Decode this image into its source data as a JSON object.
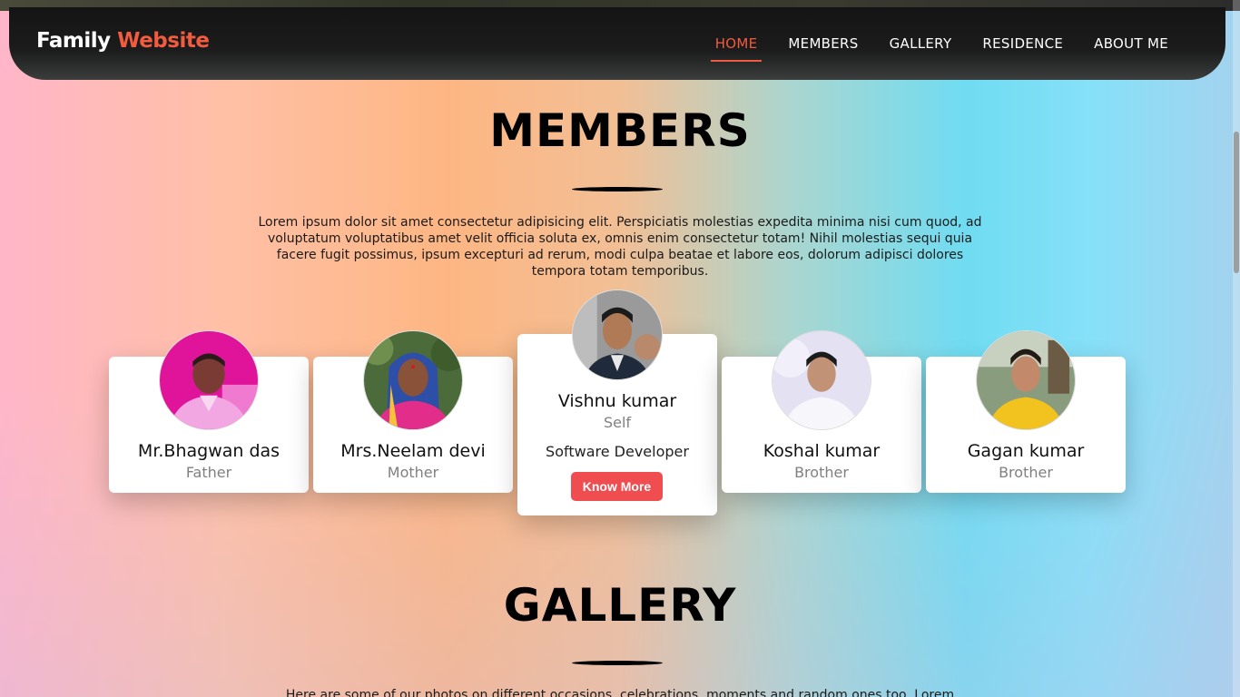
{
  "header": {
    "logo_text": "Family",
    "logo_accent": "Website",
    "nav": [
      {
        "label": "HOME"
      },
      {
        "label": "MEMBERS"
      },
      {
        "label": "GALLERY"
      },
      {
        "label": "RESIDENCE"
      },
      {
        "label": "ABOUT ME"
      }
    ],
    "active_nav": "HOME"
  },
  "members": {
    "title": "MEMBERS",
    "description": "Lorem ipsum dolor sit amet consectetur adipisicing elit. Perspiciatis molestias expedita minima nisi cum quod, ad voluptatum voluptatibus amet velit officia soluta ex, omnis enim consectetur totam! Nihil molestias sequi quia facere fugit possimus, ipsum excepturi ad rerum, modi culpa beatae et labore eos, dolorum adipisci dolores tempora totam temporibus.",
    "cards": [
      {
        "name": "Mr.Bhagwan das",
        "role": "Father"
      },
      {
        "name": "Mrs.Neelam devi",
        "role": "Mother"
      },
      {
        "name": "Vishnu kumar",
        "role": "Self",
        "job": "Software Developer",
        "button": "Know More"
      },
      {
        "name": "Koshal kumar",
        "role": "Brother"
      },
      {
        "name": "Gagan kumar",
        "role": "Brother"
      }
    ]
  },
  "gallery": {
    "title": "GALLERY",
    "description": "Here are some of our photos on different occasions, celebrations, moments and random ones too. Lorem"
  },
  "colors": {
    "accent": "#f15b3f",
    "button": "#ef4d4f",
    "navbar": "#1a1a1a"
  }
}
